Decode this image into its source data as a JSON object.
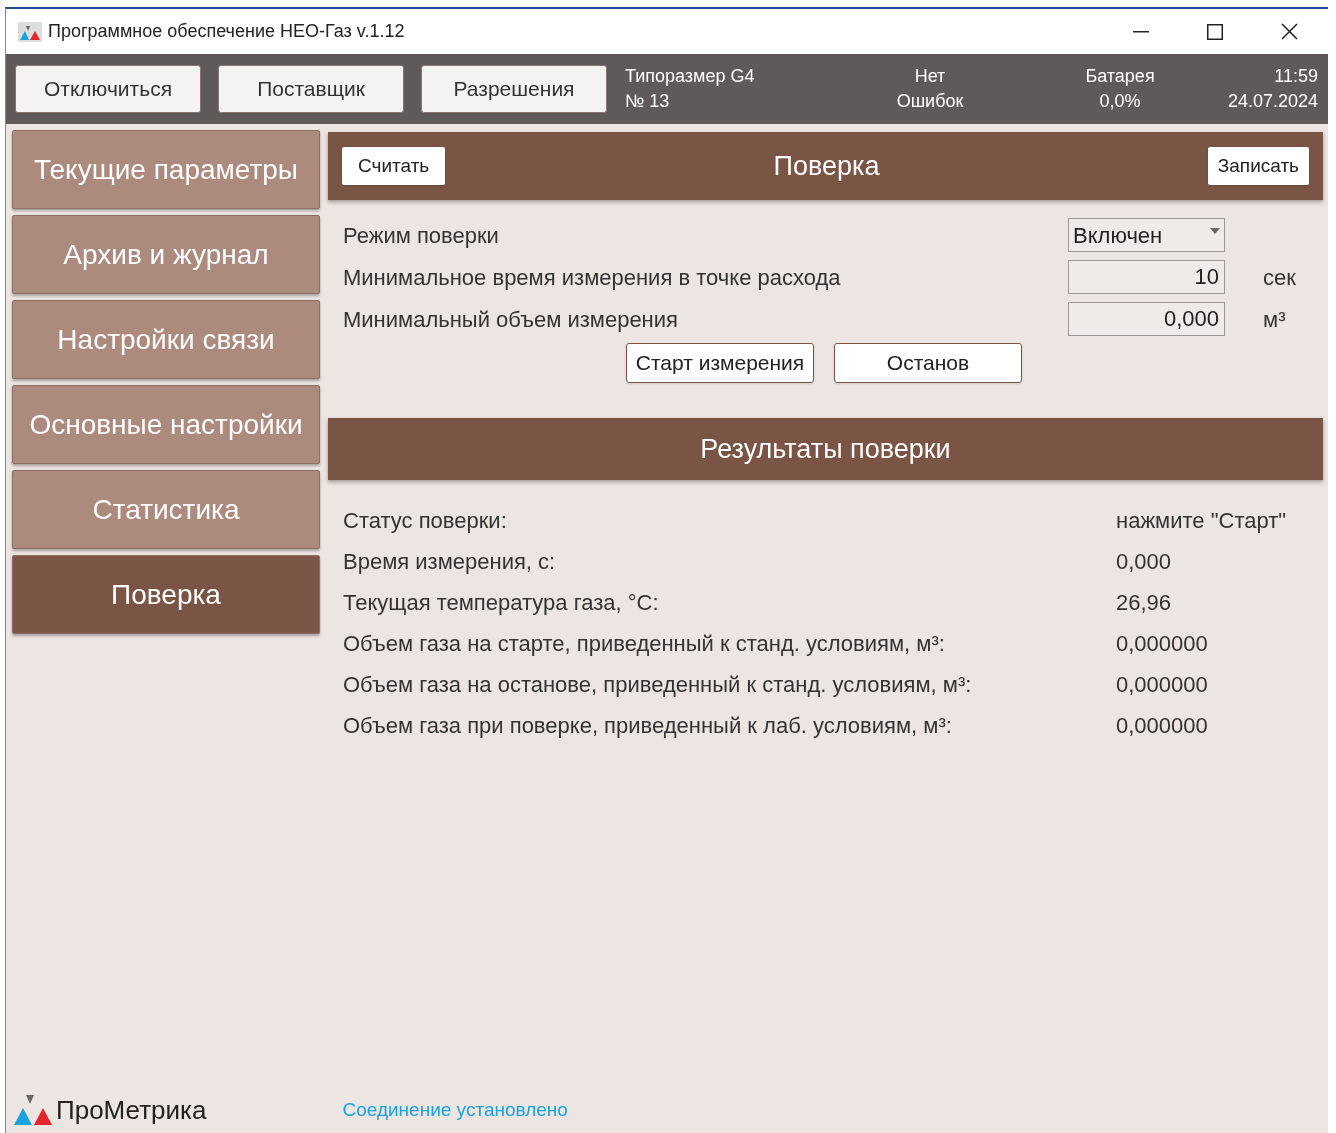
{
  "window": {
    "title": "Программное обеспечение НЕО-Газ v.1.12"
  },
  "toolbar": {
    "buttons": [
      "Отключиться",
      "Поставщик",
      "Разрешения"
    ],
    "size": [
      "Типоразмер G4",
      "№ 13"
    ],
    "errors": [
      "Нет",
      "Ошибок"
    ],
    "battery": [
      "Батарея",
      "0,0%"
    ],
    "clock": [
      "11:59",
      "24.07.2024"
    ]
  },
  "sidebar": {
    "items": [
      {
        "label": "Текущие параметры",
        "selected": false
      },
      {
        "label": "Архив и журнал",
        "selected": false
      },
      {
        "label": "Настройки связи",
        "selected": false
      },
      {
        "label": "Основные настройки",
        "selected": false
      },
      {
        "label": "Статистика",
        "selected": false
      },
      {
        "label": "Поверка",
        "selected": true
      }
    ]
  },
  "header": {
    "title": "Поверка",
    "read_button": "Считать",
    "write_button": "Записать"
  },
  "settings": [
    {
      "kind": "select",
      "label": "Режим поверки",
      "value": "Включен"
    },
    {
      "kind": "number",
      "label": "Минимальное время измерения в точке расхода",
      "value": "10",
      "unit": "сек"
    },
    {
      "kind": "number",
      "label": "Минимальный объем измерения",
      "value": "0,000",
      "unit": "м³"
    }
  ],
  "actions": [
    "Старт измерения",
    "Останов"
  ],
  "results": {
    "title": "Результаты поверки",
    "rows": [
      {
        "label": "Статус поверки:",
        "value": "нажмите \"Старт\""
      },
      {
        "label": "Время измерения, с:",
        "value": "0,000"
      },
      {
        "label": "Текущая температура газа, °С:",
        "value": "26,96"
      },
      {
        "label": "Объем газа на старте, приведенный к станд. условиям, м³:",
        "value": "0,000000"
      },
      {
        "label": "Объем газа на останове, приведенный к станд. условиям, м³:",
        "value": "0,000000"
      },
      {
        "label": "Объем газа при поверке, приведенный к лаб. условиям, м³:",
        "value": "0,000000"
      }
    ]
  },
  "footer": {
    "brand": "ПроМетрика",
    "status": "Соединение установлено"
  }
}
